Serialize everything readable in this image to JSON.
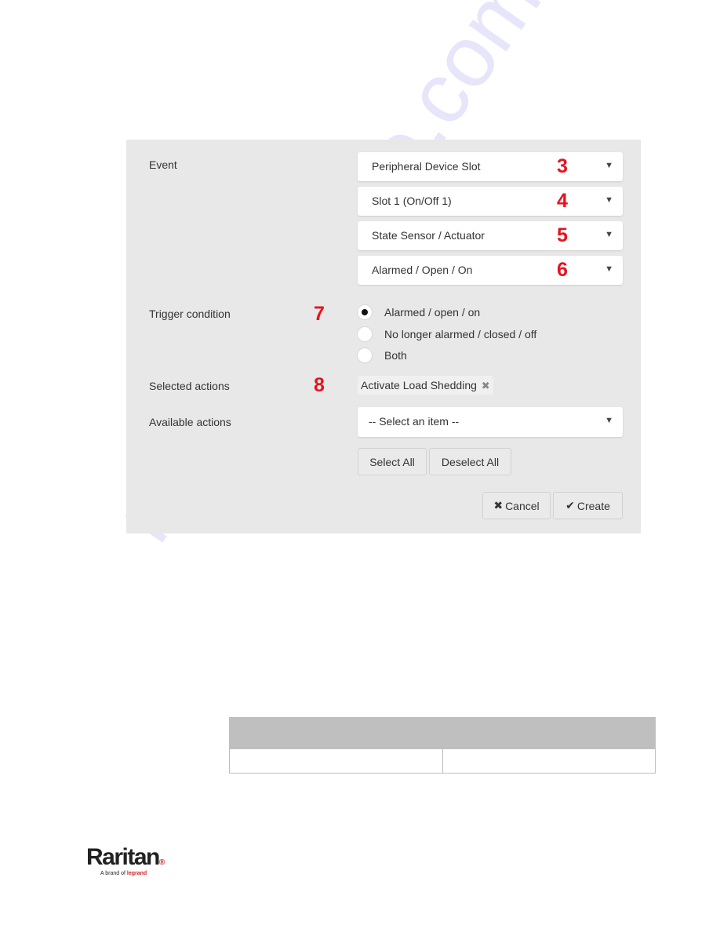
{
  "form": {
    "event_label": "Event",
    "event_selects": [
      {
        "value": "Peripheral Device Slot",
        "callout": "3"
      },
      {
        "value": "Slot 1 (On/Off 1)",
        "callout": "4"
      },
      {
        "value": "State Sensor / Actuator",
        "callout": "5"
      },
      {
        "value": "Alarmed / Open / On",
        "callout": "6"
      }
    ],
    "trigger_label": "Trigger condition",
    "trigger_callout": "7",
    "trigger_options": [
      {
        "label": "Alarmed / open / on",
        "checked": true
      },
      {
        "label": "No longer alarmed / closed / off",
        "checked": false
      },
      {
        "label": "Both",
        "checked": false
      }
    ],
    "selected_actions_label": "Selected actions",
    "selected_actions_callout": "8",
    "selected_actions": [
      {
        "label": "Activate Load Shedding",
        "remove_icon": "✖"
      }
    ],
    "available_actions_label": "Available actions",
    "available_actions_select": "-- Select an item --",
    "select_all_label": "Select All",
    "deselect_all_label": "Deselect All",
    "cancel_icon": "✖",
    "cancel_label": "Cancel",
    "create_icon": "✔",
    "create_label": "Create",
    "caret_icon": "▼"
  },
  "colors": {
    "callout": "#e8121b",
    "panel_bg": "#e8e8e8",
    "table_header": "#bfbfbf"
  },
  "footer": {
    "brand": "Raritan",
    "brand_dot": "®",
    "tagline_prefix": "A brand of",
    "tagline_brand": "legrand"
  },
  "watermark": "manualshive.com"
}
